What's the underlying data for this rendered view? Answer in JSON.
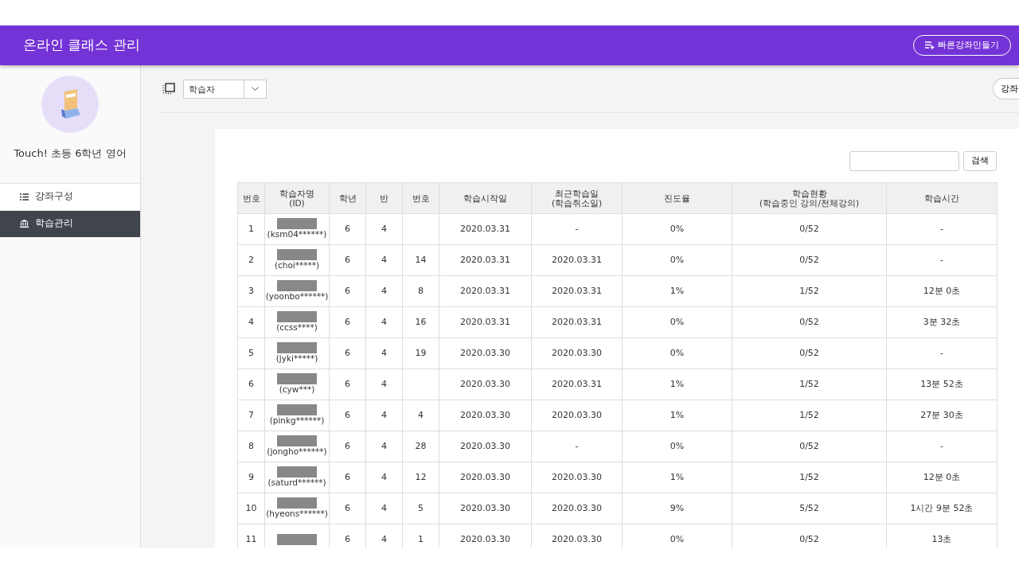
{
  "header": {
    "title": "온라인 클래스 관리",
    "quick_button": "빠른강좌만들기"
  },
  "sidebar": {
    "course_title": "Touch! 초등 6학년 영어",
    "items": [
      {
        "label": "강좌구성",
        "selected": false
      },
      {
        "label": "학습관리",
        "selected": true
      }
    ]
  },
  "toolbar": {
    "select_value": "학습자",
    "right_button": "강좌"
  },
  "search": {
    "button": "검색"
  },
  "table": {
    "columns": [
      "번호",
      "학습자명\n(ID)",
      "학년",
      "반",
      "번호",
      "학습시작일",
      "최근학습일\n(학습취소일)",
      "진도율",
      "학습현황\n(학습중인 강의/전체강의)",
      "학습시간"
    ],
    "rows": [
      {
        "no": "1",
        "id": "(ksm04******)",
        "grade": "6",
        "class": "4",
        "number": "",
        "start": "2020.03.31",
        "recent": "-",
        "progress": "0%",
        "status": "0/52",
        "time": "-"
      },
      {
        "no": "2",
        "id": "(choi*****)",
        "grade": "6",
        "class": "4",
        "number": "14",
        "start": "2020.03.31",
        "recent": "2020.03.31",
        "progress": "0%",
        "status": "0/52",
        "time": "-"
      },
      {
        "no": "3",
        "id": "(yoonbo******)",
        "grade": "6",
        "class": "4",
        "number": "8",
        "start": "2020.03.31",
        "recent": "2020.03.31",
        "progress": "1%",
        "status": "1/52",
        "time": "12분 0초"
      },
      {
        "no": "4",
        "id": "(ccss****)",
        "grade": "6",
        "class": "4",
        "number": "16",
        "start": "2020.03.31",
        "recent": "2020.03.31",
        "progress": "0%",
        "status": "0/52",
        "time": "3분 32초"
      },
      {
        "no": "5",
        "id": "(jyki*****)",
        "grade": "6",
        "class": "4",
        "number": "19",
        "start": "2020.03.30",
        "recent": "2020.03.30",
        "progress": "0%",
        "status": "0/52",
        "time": "-"
      },
      {
        "no": "6",
        "id": "(cyw***)",
        "grade": "6",
        "class": "4",
        "number": "",
        "start": "2020.03.30",
        "recent": "2020.03.31",
        "progress": "1%",
        "status": "1/52",
        "time": "13분 52초"
      },
      {
        "no": "7",
        "id": "(pinkg******)",
        "grade": "6",
        "class": "4",
        "number": "4",
        "start": "2020.03.30",
        "recent": "2020.03.30",
        "progress": "1%",
        "status": "1/52",
        "time": "27분 30초"
      },
      {
        "no": "8",
        "id": "(jongho******)",
        "grade": "6",
        "class": "4",
        "number": "28",
        "start": "2020.03.30",
        "recent": "-",
        "progress": "0%",
        "status": "0/52",
        "time": "-"
      },
      {
        "no": "9",
        "id": "(saturd******)",
        "grade": "6",
        "class": "4",
        "number": "12",
        "start": "2020.03.30",
        "recent": "2020.03.30",
        "progress": "1%",
        "status": "1/52",
        "time": "12분 0초"
      },
      {
        "no": "10",
        "id": "(hyeons******)",
        "grade": "6",
        "class": "4",
        "number": "5",
        "start": "2020.03.30",
        "recent": "2020.03.30",
        "progress": "9%",
        "status": "5/52",
        "time": "1시간 9분 52초"
      },
      {
        "no": "11",
        "grade": "6",
        "class": "4",
        "number": "1",
        "start": "2020.03.30",
        "recent": "2020.03.30",
        "progress": "0%",
        "status": "0/52",
        "time": "13초"
      }
    ]
  }
}
